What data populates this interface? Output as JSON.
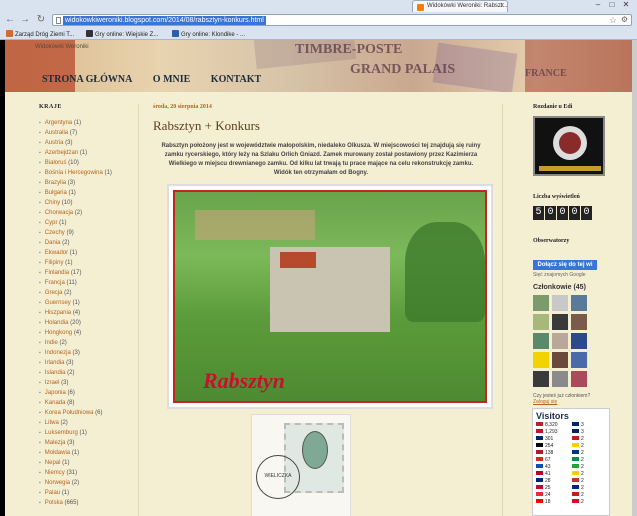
{
  "browser": {
    "tab_title": "Widokówki Weroniki: Rabszt...",
    "tab_close": "x",
    "window_buttons": [
      "–",
      "□",
      "✕"
    ],
    "url": "widokowkiweroniki.blogspot.com/2014/08/rabsztyn-konkurs.html",
    "nav": {
      "back": "←",
      "forward": "→",
      "reload": "↻"
    },
    "bookmarks": [
      {
        "label": "Zarząd Dróg Ziemi T...",
        "color": "#d36b2e"
      },
      {
        "label": "Gry online: Wiejskie Z...",
        "color": "#333"
      },
      {
        "label": "Gry online: Klondike - ...",
        "color": "#2a5db0"
      }
    ]
  },
  "header": {
    "top_text": "Widokówki Weroniki",
    "stamp_texts": [
      "TIMBRE-POSTE",
      "GRAND PALAIS",
      "FRANCE"
    ],
    "menu": [
      "STRONA GŁÓWNA",
      "O MNIE",
      "KONTAKT"
    ]
  },
  "left_sidebar": {
    "title": "KRAJE",
    "countries": [
      {
        "name": "Argentyna",
        "count": "(1)"
      },
      {
        "name": "Australia",
        "count": "(7)"
      },
      {
        "name": "Austria",
        "count": "(3)"
      },
      {
        "name": "Azerbejdżan",
        "count": "(1)"
      },
      {
        "name": "Białoruś",
        "count": "(10)"
      },
      {
        "name": "Bośnia i Hercegowina",
        "count": "(1)"
      },
      {
        "name": "Brazylia",
        "count": "(3)"
      },
      {
        "name": "Bułgaria",
        "count": "(1)"
      },
      {
        "name": "Chiny",
        "count": "(10)"
      },
      {
        "name": "Chorwacja",
        "count": "(2)"
      },
      {
        "name": "Cypr",
        "count": "(1)"
      },
      {
        "name": "Czechy",
        "count": "(9)"
      },
      {
        "name": "Dania",
        "count": "(2)"
      },
      {
        "name": "Ekwador",
        "count": "(1)"
      },
      {
        "name": "Filipiny",
        "count": "(1)"
      },
      {
        "name": "Finlandia",
        "count": "(17)"
      },
      {
        "name": "Francja",
        "count": "(11)"
      },
      {
        "name": "Grecja",
        "count": "(2)"
      },
      {
        "name": "Guernsey",
        "count": "(1)"
      },
      {
        "name": "Hiszpania",
        "count": "(4)"
      },
      {
        "name": "Holandia",
        "count": "(20)"
      },
      {
        "name": "Hongkong",
        "count": "(4)"
      },
      {
        "name": "Indie",
        "count": "(2)"
      },
      {
        "name": "Indonezja",
        "count": "(3)"
      },
      {
        "name": "Irlandia",
        "count": "(3)"
      },
      {
        "name": "Islandia",
        "count": "(2)"
      },
      {
        "name": "Izrael",
        "count": "(3)"
      },
      {
        "name": "Japonia",
        "count": "(6)"
      },
      {
        "name": "Kanada",
        "count": "(8)"
      },
      {
        "name": "Korea Południowa",
        "count": "(6)"
      },
      {
        "name": "Litwa",
        "count": "(2)"
      },
      {
        "name": "Luksemburg",
        "count": "(1)"
      },
      {
        "name": "Malezja",
        "count": "(3)"
      },
      {
        "name": "Mołdawia",
        "count": "(1)"
      },
      {
        "name": "Nepal",
        "count": "(1)"
      },
      {
        "name": "Niemcy",
        "count": "(31)"
      },
      {
        "name": "Norwegia",
        "count": "(2)"
      },
      {
        "name": "Palau",
        "count": "(1)"
      },
      {
        "name": "Polska",
        "count": "(665)"
      }
    ]
  },
  "post": {
    "date": "środa, 20 sierpnia 2014",
    "title": "Rabsztyn + Konkurs",
    "body": "Rabsztyn położony jest w województwie małopolskim, niedaleko Olkusza. W miejscowości tej znajdują się ruiny zamku rycerskiego, który leży na Szlaku Orlich Gniazd. Zamek murowany został postawiony przez Kazimierza Wielkiego w miejscu drewnianego zamku. Od kilku lat trwają tu prace mające na celu rekonstrukcję zamku. Widók ten otrzymałam od Bogny.",
    "photo_caption": "Rabsztyn",
    "postmark_text": "WIELICZKA"
  },
  "right_sidebar": {
    "award_title": "Rozdanie u Edi",
    "counter_title": "Liczba wyświetleń",
    "counter_digits": [
      "5",
      "0",
      "0",
      "0",
      "0"
    ],
    "followers_title": "Obserwatorzy",
    "follow_button": "Dołącz się do tej wi",
    "google_note": "Sięć znajomych Google",
    "members_title": "Członkowie (45)",
    "avatar_colors": [
      "#7b9b6a",
      "#c8c8c8",
      "#5a7a9a",
      "#a8b87a",
      "#3a3a3a",
      "#7a5a4a",
      "#5a8a6a",
      "#b8a89a",
      "#2a4a8a",
      "#f2d300",
      "#6a4a3a",
      "#4a6aaa",
      "#3a3a3a",
      "#8a8a8a",
      "#aa4a5a"
    ],
    "already_member": "Czy jesteś już członkiem?",
    "login_link": "Zaloguj się",
    "visitors_title": "Visitors",
    "visitors": [
      {
        "flag": "#b22234",
        "count": "8,320"
      },
      {
        "flag": "#002868",
        "count": "3"
      },
      {
        "flag": "#c8102e",
        "count": "1,293"
      },
      {
        "flag": "#012169",
        "count": "3"
      },
      {
        "flag": "#012169",
        "count": "301"
      },
      {
        "flag": "#ce1126",
        "count": "2"
      },
      {
        "flag": "#000000",
        "count": "254"
      },
      {
        "flag": "#ffcc00",
        "count": "2"
      },
      {
        "flag": "#ae1c28",
        "count": "138"
      },
      {
        "flag": "#003580",
        "count": "2"
      },
      {
        "flag": "#d52b1e",
        "count": "67"
      },
      {
        "flag": "#009246",
        "count": "2"
      },
      {
        "flag": "#0055a4",
        "count": "43"
      },
      {
        "flag": "#239f40",
        "count": "2"
      },
      {
        "flag": "#bc002d",
        "count": "41"
      },
      {
        "flag": "#ffce00",
        "count": "2"
      },
      {
        "flag": "#00247d",
        "count": "28"
      },
      {
        "flag": "#cd2e3a",
        "count": "2"
      },
      {
        "flag": "#c60b1e",
        "count": "25"
      },
      {
        "flag": "#002395",
        "count": "2"
      },
      {
        "flag": "#ed2939",
        "count": "24"
      },
      {
        "flag": "#d7141a",
        "count": "2"
      },
      {
        "flag": "#ff0000",
        "count": "18"
      },
      {
        "flag": "#ce1126",
        "count": "2"
      }
    ]
  }
}
